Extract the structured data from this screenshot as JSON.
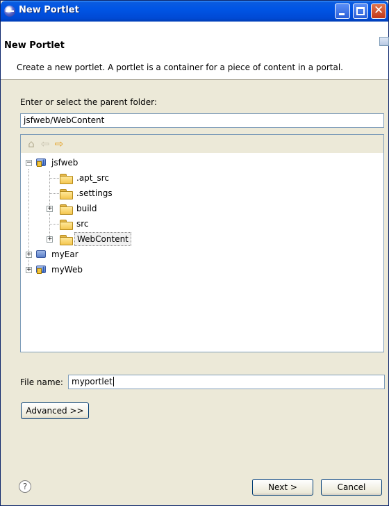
{
  "window": {
    "title": "New Portlet"
  },
  "banner": {
    "title": "New Portlet",
    "description": "Create a new portlet. A portlet is a container for a piece of content in a portal."
  },
  "parent_folder": {
    "label": "Enter or select the parent folder:",
    "value": "jsfweb/WebContent"
  },
  "tree_toolbar": {
    "icons": [
      "home-icon",
      "back-arrow-icon",
      "forward-arrow-icon"
    ]
  },
  "tree": {
    "jsfweb": "jsfweb",
    "apt_src": ".apt_src",
    "settings": ".settings",
    "build": "build",
    "src": "src",
    "webcontent": "WebContent",
    "myear": "myEar",
    "myweb": "myWeb"
  },
  "file_name": {
    "label": "File name:",
    "value": "myportlet"
  },
  "buttons": {
    "advanced": "Advanced >>",
    "next": "Next >",
    "cancel": "Cancel",
    "help": "?"
  },
  "colors": {
    "titlebar": "#0055e5",
    "dialog_bg": "#ece9d8",
    "selection_outline": "#888888"
  }
}
